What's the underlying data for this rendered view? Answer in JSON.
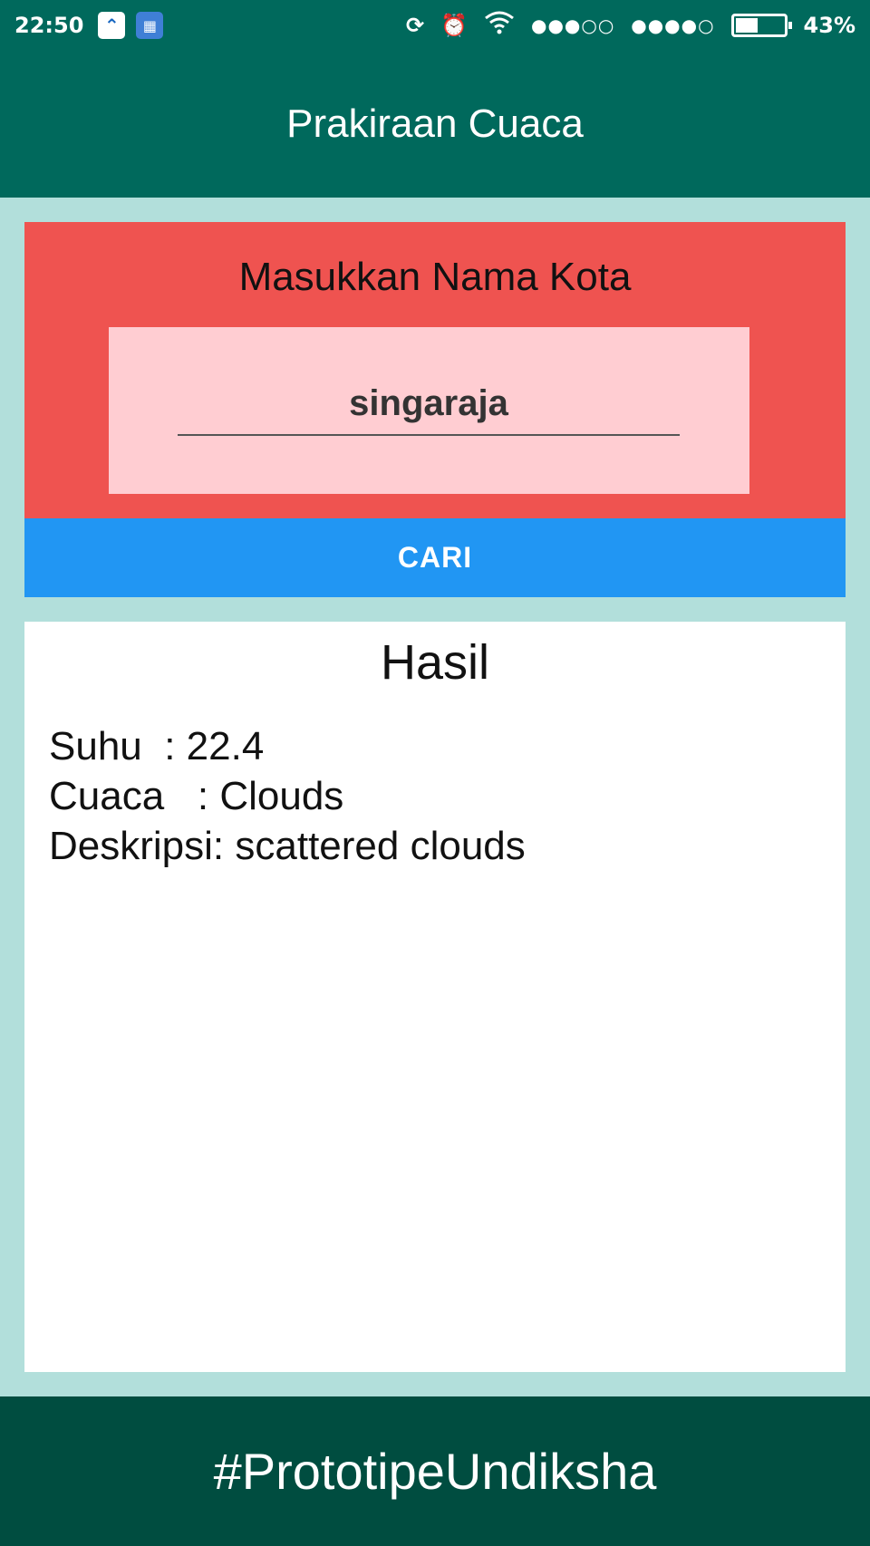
{
  "status_bar": {
    "time": "22:50",
    "signal_1": "●●●○○",
    "signal_2": "●●●●○",
    "battery_percent": "43%",
    "battery_level": 0.43
  },
  "app_bar": {
    "title": "Prakiraan Cuaca"
  },
  "search": {
    "title": "Masukkan Nama Kota",
    "input_value": "singaraja",
    "button_label": "CARI"
  },
  "result": {
    "title": "Hasil",
    "rows": [
      {
        "label": "Suhu  ",
        "value": ": 22.4"
      },
      {
        "label": "Cuaca   ",
        "value": ": Clouds"
      },
      {
        "label": "Deskripsi",
        "value": ": scattered clouds"
      }
    ]
  },
  "footer": {
    "text": "#PrototipeUndiksha"
  },
  "colors": {
    "primary": "#00695c",
    "primary_dark": "#004d40",
    "background": "#b2dfdb",
    "search_card": "#ef5350",
    "input_box": "#ffcdd2",
    "button": "#2196f3"
  }
}
